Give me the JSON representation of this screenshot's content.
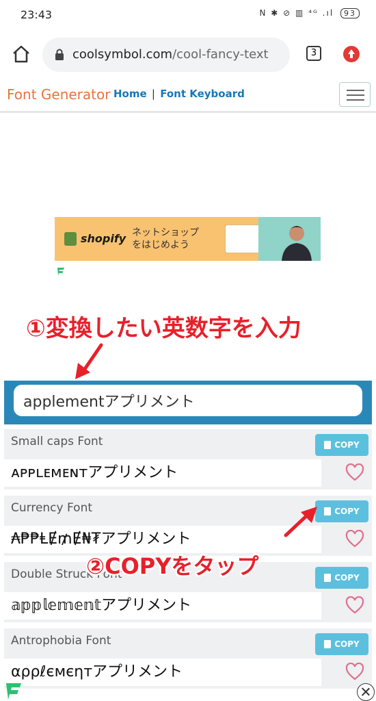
{
  "status_bar": {
    "time": "23:43",
    "icons_text": "N ✱ ⊘ ▥ ⁴ᴳ .ıl",
    "battery": "93"
  },
  "browser": {
    "url_host": "coolsymbol.com",
    "url_path": "/cool-fancy-text",
    "tab_count": "3",
    "icons": [
      "home-icon",
      "lock-icon",
      "upgrade-icon"
    ]
  },
  "site_nav": {
    "brand": "Font Generator",
    "home": "Home",
    "separator": "|",
    "keyboard": "Font Keyboard"
  },
  "ad": {
    "brand": "shopify",
    "copy_line1": "ネットショップ",
    "copy_line2": "をはじめよう"
  },
  "annotations": {
    "step1": "①変換したい英数字を入力",
    "step2": "②COPYをタップ"
  },
  "input": {
    "value": "applementアプリメント"
  },
  "copy_label": "COPY",
  "font_cards": [
    {
      "name": "Small caps Font",
      "result": "ᴀᴘᴘʟᴇᴍᴇɴᴛアプリメント"
    },
    {
      "name": "Currency Font",
      "result": "₳₱₱ⱠɆ₥Ɇ₦₮アプリメント"
    },
    {
      "name": "Double Struck Font",
      "result": "𝕒𝕡𝕡𝕝𝕖𝕞𝕖𝕟𝕥アプリメント"
    },
    {
      "name": "Antrophobia Font",
      "result": "αρρℓємєηтアプリメント"
    }
  ],
  "colors": {
    "accent_blue": "#2a88b8",
    "copy_btn": "#5bc0de",
    "brand_orange": "#e8743b",
    "annotation_red": "#e8202a",
    "heart_pink": "#e0708a"
  }
}
